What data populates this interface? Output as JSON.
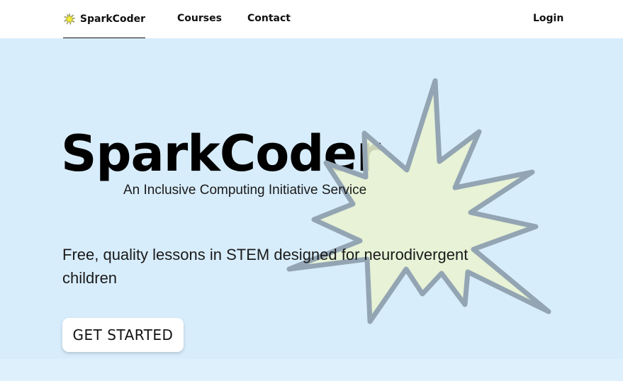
{
  "nav": {
    "brand": "SparkCoder",
    "brand_icon": "spark-burst-icon",
    "links": [
      "Courses",
      "Contact"
    ],
    "login": "Login"
  },
  "hero": {
    "title": "SparkCoder",
    "subtitle": "An Inclusive Computing Initiative Service",
    "description": "Free, quality lessons in STEM designed for neurodivergent children",
    "cta": "GET STARTED",
    "decoration_icon": "spark-burst-icon"
  },
  "colors": {
    "hero_background": "#d8edfc",
    "burst_fill": "#e8f3d0",
    "burst_stroke": "#93a5b3",
    "brand_icon_fill": "#f2ec3a"
  }
}
